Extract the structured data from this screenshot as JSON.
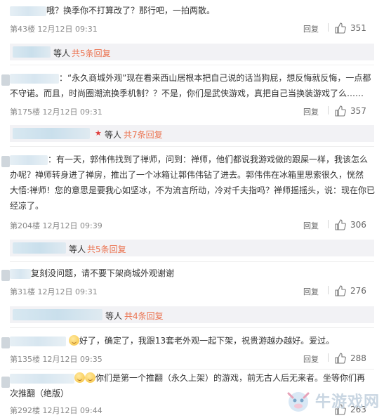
{
  "comments": [
    {
      "text": "哦？换季你不打算改了？那行吧，一拍两散。",
      "floor": "第43楼",
      "date": "12月12日 09:31",
      "reply": "回复",
      "likes": "351"
    },
    {
      "line1": "：“永久商城外观”现在看来西山居根本把自己说的话当狗屁，想反悔就反悔，一点都",
      "line2": "不守诺。而且，时尚圈潮流换季机制？？不是，你们是武侠游戏，真把自己当换装游戏了么……",
      "floor": "第175楼",
      "date": "12月12日 09:31",
      "reply": "回复",
      "likes": "357"
    },
    {
      "line1": "：有一天，郭伟伟找到了禅师，问到：禅师，他们都说我游戏做的跟屎一样，我该怎么",
      "line2": "办呢？禅师转身进了禅房，推出了一个冰箱让郭伟伟钻了进去。郭伟伟在冰箱里思索很久，恍然",
      "line3": "大悟:禅师！您的意思是要我心如坚冰，不为流言所动，冷对千夫指吗？禅师摇摇头，说：现在你已",
      "line4": "经凉了。",
      "floor": "第204楼",
      "date": "12月12日 09:39",
      "reply": "回复",
      "likes": "306"
    },
    {
      "text": "复刻没问题，请不要下架商城外观谢谢",
      "floor": "第31楼",
      "date": "12月12日 09:31",
      "reply": "回复",
      "likes": "276"
    },
    {
      "text": "好了，确定了，我跟13套老外观一起下架，祝贵游越办越好。爱过。",
      "floor": "第135楼",
      "date": "12月12日 09:35",
      "reply": "回复",
      "likes": "288"
    },
    {
      "line1": "你们是第一个推翻（永久上架）的游戏，前无古人后无来者。坐等你们再",
      "line2": "次推翻（绝版）",
      "floor": "第292楼",
      "date": "12月12日 09:44",
      "reply": "回复",
      "likes": "263"
    }
  ],
  "subreplies": [
    {
      "people": "等人",
      "link": "共5条回复"
    },
    {
      "people": "等人",
      "link": "共7条回复",
      "star": "★"
    },
    {
      "people": "等人",
      "link": "共5条回复"
    },
    {
      "people": "等人",
      "link": "共4条回复"
    }
  ],
  "watermark": {
    "name": "牛游戏网"
  },
  "colors": {
    "link": "#eb7350",
    "meta": "#888888",
    "subreply_bg": "#f2f2f5"
  }
}
